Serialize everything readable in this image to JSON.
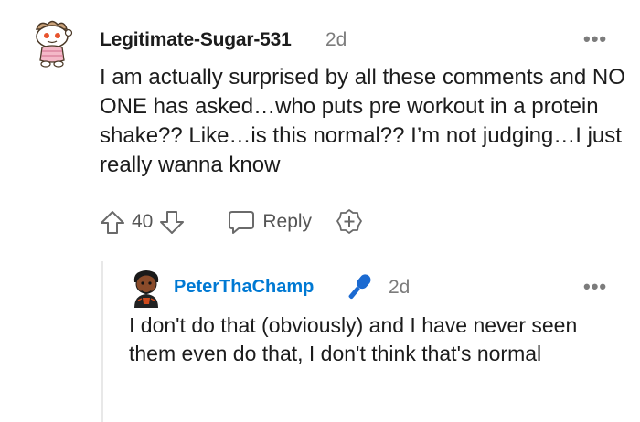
{
  "comments": [
    {
      "author": "Legitimate-Sugar-531",
      "age": "2d",
      "more": "•••",
      "body": "I am actually surprised by all these comments and NO ONE has asked…who puts pre workout in a protein shake?? Like…is this normal?? I’m not judging…I just really wanna know",
      "votes": "40",
      "reply_label": "Reply",
      "icons": {
        "avatar": "snoo-avatar-icon",
        "upvote": "arrow-up-icon",
        "downvote": "arrow-down-icon",
        "reply": "speech-bubble-icon",
        "award": "plus-circle-icon"
      }
    },
    {
      "author": "PeterThaChamp",
      "age": "2d",
      "more": "•••",
      "body": "I don't do that (obviously) and I have never seen them even do that, I don't think that's normal",
      "icons": {
        "avatar": "user-avatar-icon",
        "flair": "microphone-icon"
      }
    }
  ],
  "colors": {
    "author_link": "#0079d3",
    "muted": "#7c7c7c",
    "text": "#1c1c1c",
    "thread_line": "#e8e8e8"
  }
}
